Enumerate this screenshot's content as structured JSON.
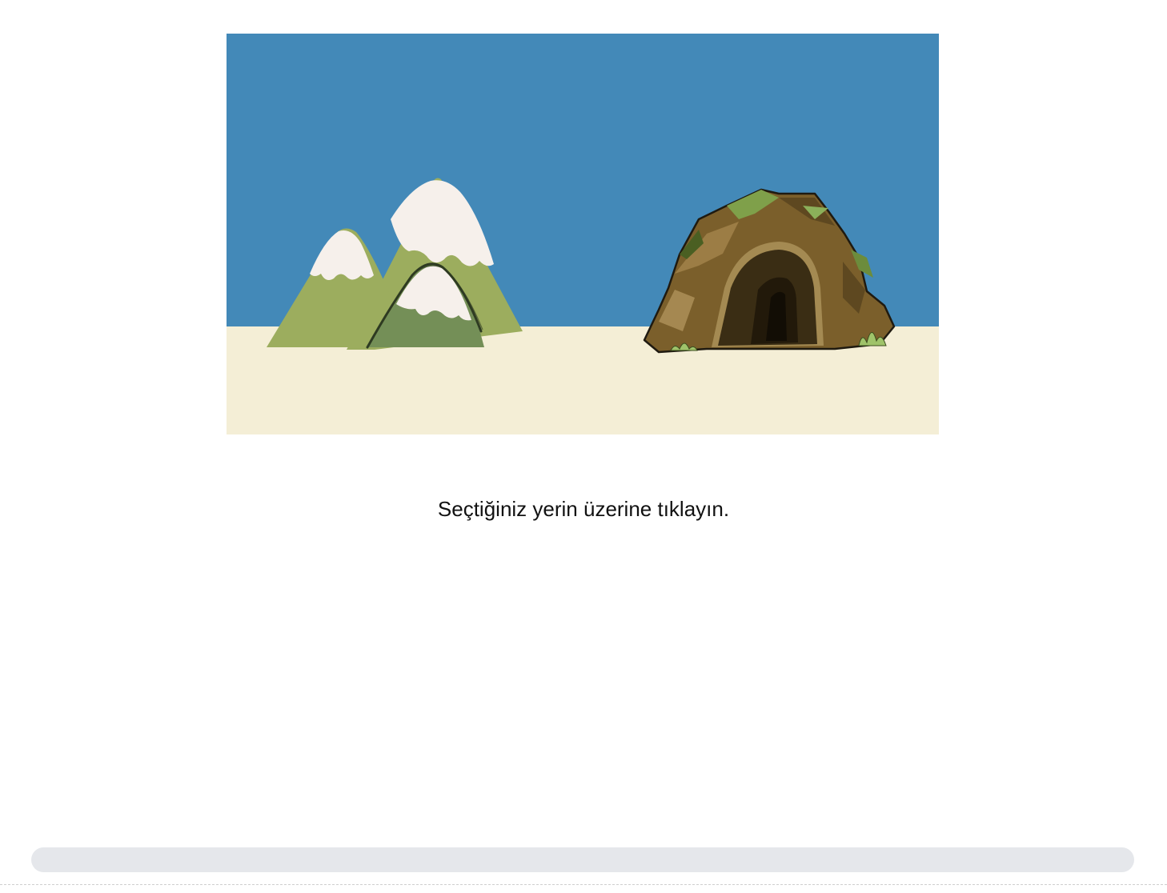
{
  "instruction": "Seçtiğiniz yerin üzerine tıklayın.",
  "scene": {
    "choices": [
      {
        "id": "mountains",
        "icon": "mountains-icon"
      },
      {
        "id": "cave",
        "icon": "cave-icon"
      }
    ],
    "colors": {
      "sky": "#4389b8",
      "ground": "#f4eed6",
      "mountain_light": "#9cad5e",
      "mountain_dark": "#748f57",
      "snow": "#f6f0eb",
      "cave_rock": "#7b5f2b",
      "cave_shadow": "#3a2d14",
      "moss": "#7fa04a"
    }
  },
  "progress": {
    "value_percent": 0
  }
}
